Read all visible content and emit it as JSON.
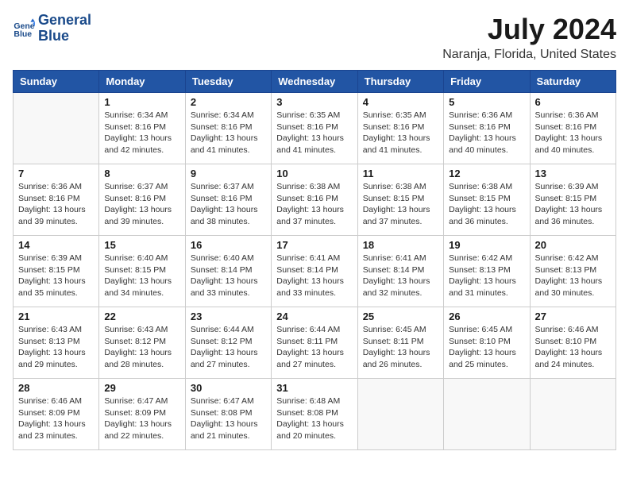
{
  "logo": {
    "line1": "General",
    "line2": "Blue"
  },
  "title": "July 2024",
  "location": "Naranja, Florida, United States",
  "weekdays": [
    "Sunday",
    "Monday",
    "Tuesday",
    "Wednesday",
    "Thursday",
    "Friday",
    "Saturday"
  ],
  "weeks": [
    [
      {
        "day": "",
        "info": ""
      },
      {
        "day": "1",
        "info": "Sunrise: 6:34 AM\nSunset: 8:16 PM\nDaylight: 13 hours\nand 42 minutes."
      },
      {
        "day": "2",
        "info": "Sunrise: 6:34 AM\nSunset: 8:16 PM\nDaylight: 13 hours\nand 41 minutes."
      },
      {
        "day": "3",
        "info": "Sunrise: 6:35 AM\nSunset: 8:16 PM\nDaylight: 13 hours\nand 41 minutes."
      },
      {
        "day": "4",
        "info": "Sunrise: 6:35 AM\nSunset: 8:16 PM\nDaylight: 13 hours\nand 41 minutes."
      },
      {
        "day": "5",
        "info": "Sunrise: 6:36 AM\nSunset: 8:16 PM\nDaylight: 13 hours\nand 40 minutes."
      },
      {
        "day": "6",
        "info": "Sunrise: 6:36 AM\nSunset: 8:16 PM\nDaylight: 13 hours\nand 40 minutes."
      }
    ],
    [
      {
        "day": "7",
        "info": "Sunrise: 6:36 AM\nSunset: 8:16 PM\nDaylight: 13 hours\nand 39 minutes."
      },
      {
        "day": "8",
        "info": "Sunrise: 6:37 AM\nSunset: 8:16 PM\nDaylight: 13 hours\nand 39 minutes."
      },
      {
        "day": "9",
        "info": "Sunrise: 6:37 AM\nSunset: 8:16 PM\nDaylight: 13 hours\nand 38 minutes."
      },
      {
        "day": "10",
        "info": "Sunrise: 6:38 AM\nSunset: 8:16 PM\nDaylight: 13 hours\nand 37 minutes."
      },
      {
        "day": "11",
        "info": "Sunrise: 6:38 AM\nSunset: 8:15 PM\nDaylight: 13 hours\nand 37 minutes."
      },
      {
        "day": "12",
        "info": "Sunrise: 6:38 AM\nSunset: 8:15 PM\nDaylight: 13 hours\nand 36 minutes."
      },
      {
        "day": "13",
        "info": "Sunrise: 6:39 AM\nSunset: 8:15 PM\nDaylight: 13 hours\nand 36 minutes."
      }
    ],
    [
      {
        "day": "14",
        "info": "Sunrise: 6:39 AM\nSunset: 8:15 PM\nDaylight: 13 hours\nand 35 minutes."
      },
      {
        "day": "15",
        "info": "Sunrise: 6:40 AM\nSunset: 8:15 PM\nDaylight: 13 hours\nand 34 minutes."
      },
      {
        "day": "16",
        "info": "Sunrise: 6:40 AM\nSunset: 8:14 PM\nDaylight: 13 hours\nand 33 minutes."
      },
      {
        "day": "17",
        "info": "Sunrise: 6:41 AM\nSunset: 8:14 PM\nDaylight: 13 hours\nand 33 minutes."
      },
      {
        "day": "18",
        "info": "Sunrise: 6:41 AM\nSunset: 8:14 PM\nDaylight: 13 hours\nand 32 minutes."
      },
      {
        "day": "19",
        "info": "Sunrise: 6:42 AM\nSunset: 8:13 PM\nDaylight: 13 hours\nand 31 minutes."
      },
      {
        "day": "20",
        "info": "Sunrise: 6:42 AM\nSunset: 8:13 PM\nDaylight: 13 hours\nand 30 minutes."
      }
    ],
    [
      {
        "day": "21",
        "info": "Sunrise: 6:43 AM\nSunset: 8:13 PM\nDaylight: 13 hours\nand 29 minutes."
      },
      {
        "day": "22",
        "info": "Sunrise: 6:43 AM\nSunset: 8:12 PM\nDaylight: 13 hours\nand 28 minutes."
      },
      {
        "day": "23",
        "info": "Sunrise: 6:44 AM\nSunset: 8:12 PM\nDaylight: 13 hours\nand 27 minutes."
      },
      {
        "day": "24",
        "info": "Sunrise: 6:44 AM\nSunset: 8:11 PM\nDaylight: 13 hours\nand 27 minutes."
      },
      {
        "day": "25",
        "info": "Sunrise: 6:45 AM\nSunset: 8:11 PM\nDaylight: 13 hours\nand 26 minutes."
      },
      {
        "day": "26",
        "info": "Sunrise: 6:45 AM\nSunset: 8:10 PM\nDaylight: 13 hours\nand 25 minutes."
      },
      {
        "day": "27",
        "info": "Sunrise: 6:46 AM\nSunset: 8:10 PM\nDaylight: 13 hours\nand 24 minutes."
      }
    ],
    [
      {
        "day": "28",
        "info": "Sunrise: 6:46 AM\nSunset: 8:09 PM\nDaylight: 13 hours\nand 23 minutes."
      },
      {
        "day": "29",
        "info": "Sunrise: 6:47 AM\nSunset: 8:09 PM\nDaylight: 13 hours\nand 22 minutes."
      },
      {
        "day": "30",
        "info": "Sunrise: 6:47 AM\nSunset: 8:08 PM\nDaylight: 13 hours\nand 21 minutes."
      },
      {
        "day": "31",
        "info": "Sunrise: 6:48 AM\nSunset: 8:08 PM\nDaylight: 13 hours\nand 20 minutes."
      },
      {
        "day": "",
        "info": ""
      },
      {
        "day": "",
        "info": ""
      },
      {
        "day": "",
        "info": ""
      }
    ]
  ]
}
